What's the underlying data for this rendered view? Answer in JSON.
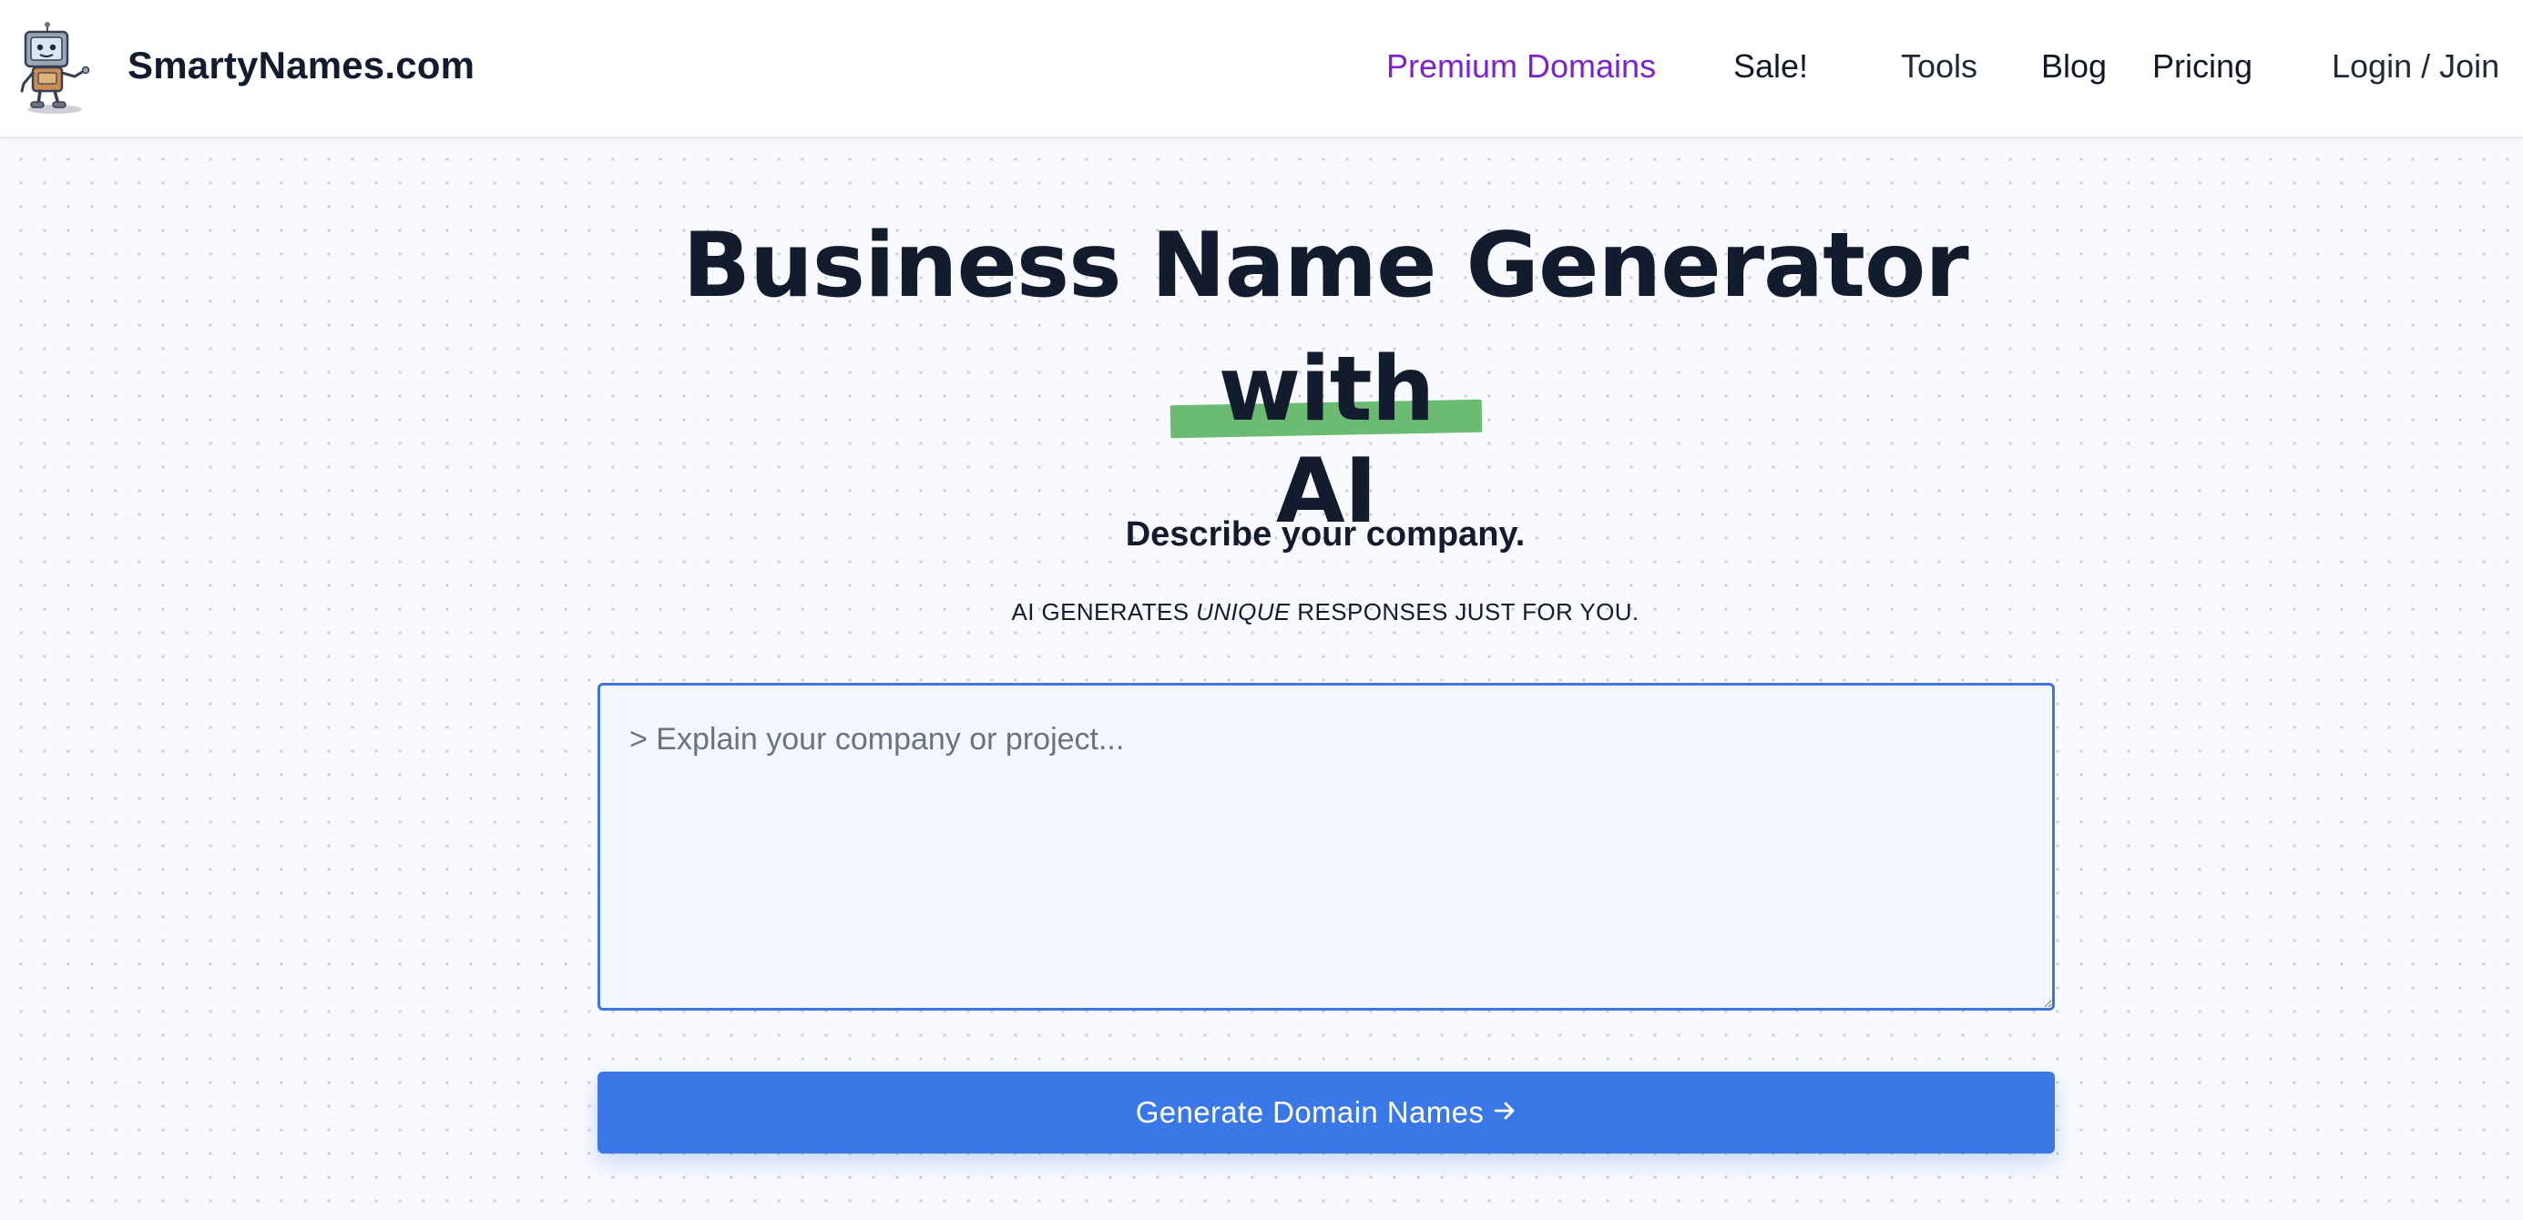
{
  "header": {
    "brand": "SmartyNames.com",
    "logo_icon": "robot-mascot-icon",
    "nav": {
      "premium_domains": "Premium Domains",
      "sale": "Sale!",
      "tools": "Tools",
      "blog": "Blog",
      "pricing": "Pricing",
      "login_join": "Login / Join"
    },
    "colors": {
      "premium_link": "#7e22ce"
    }
  },
  "hero": {
    "title_line1": "Business Name Generator",
    "title_line2": "with AI",
    "subtitle": "Describe your company.",
    "tagline_before": "AI GENERATES ",
    "tagline_emphasis": "UNIQUE",
    "tagline_after": " RESPONSES JUST FOR YOU.",
    "highlight_color": "#6cbb72"
  },
  "form": {
    "input_value": "",
    "input_placeholder": "> Explain your company or project...",
    "generate_label": "Generate Domain Names",
    "generate_icon": "arrow-right-icon",
    "accent_color": "#3b78e7"
  }
}
